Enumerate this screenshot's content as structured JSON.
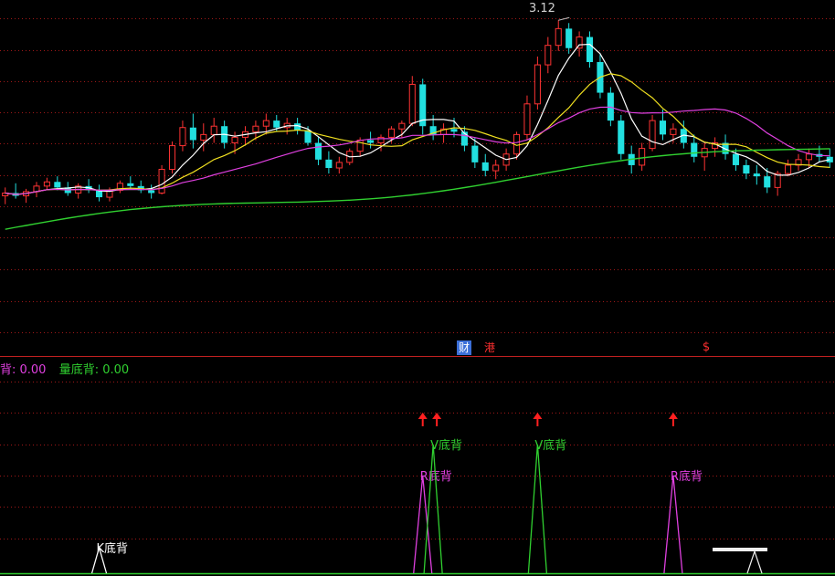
{
  "chart_data": [
    {
      "type": "candlestick",
      "peak_label": "3.12",
      "badges": [
        {
          "text": "财",
          "bg": "#3b6fd8",
          "fg": "#ffffff"
        },
        {
          "text": "港",
          "bg": "#000000",
          "fg": "#ff3030"
        },
        {
          "text": "$",
          "bg": "#000000",
          "fg": "#ff3030"
        }
      ],
      "colors": {
        "up": "#ff3333",
        "down": "#22e0e0",
        "ma5": "#ffffff",
        "ma10": "#f0e020",
        "ma20": "#e040e0",
        "ma60": "#30d030"
      },
      "price_range": [
        1.3,
        3.2
      ],
      "ohlc": [
        [
          1.86,
          1.92,
          1.8,
          1.88
        ],
        [
          1.88,
          1.95,
          1.84,
          1.86
        ],
        [
          1.86,
          1.91,
          1.81,
          1.89
        ],
        [
          1.89,
          1.96,
          1.85,
          1.93
        ],
        [
          1.93,
          1.99,
          1.9,
          1.96
        ],
        [
          1.96,
          2.0,
          1.9,
          1.92
        ],
        [
          1.92,
          1.96,
          1.86,
          1.88
        ],
        [
          1.88,
          1.95,
          1.84,
          1.93
        ],
        [
          1.93,
          1.98,
          1.88,
          1.9
        ],
        [
          1.9,
          1.94,
          1.82,
          1.85
        ],
        [
          1.85,
          1.92,
          1.82,
          1.9
        ],
        [
          1.9,
          1.97,
          1.88,
          1.95
        ],
        [
          1.95,
          2.0,
          1.91,
          1.93
        ],
        [
          1.93,
          1.97,
          1.88,
          1.9
        ],
        [
          1.9,
          1.94,
          1.84,
          1.88
        ],
        [
          1.88,
          2.08,
          1.87,
          2.05
        ],
        [
          2.05,
          2.25,
          2.02,
          2.22
        ],
        [
          2.22,
          2.4,
          2.18,
          2.35
        ],
        [
          2.35,
          2.45,
          2.2,
          2.26
        ],
        [
          2.26,
          2.38,
          2.18,
          2.3
        ],
        [
          2.3,
          2.42,
          2.24,
          2.36
        ],
        [
          2.36,
          2.4,
          2.2,
          2.24
        ],
        [
          2.24,
          2.32,
          2.16,
          2.28
        ],
        [
          2.28,
          2.36,
          2.22,
          2.32
        ],
        [
          2.32,
          2.4,
          2.26,
          2.36
        ],
        [
          2.36,
          2.45,
          2.3,
          2.4
        ],
        [
          2.4,
          2.44,
          2.32,
          2.35
        ],
        [
          2.35,
          2.42,
          2.3,
          2.38
        ],
        [
          2.38,
          2.42,
          2.3,
          2.33
        ],
        [
          2.33,
          2.36,
          2.22,
          2.24
        ],
        [
          2.24,
          2.28,
          2.08,
          2.12
        ],
        [
          2.12,
          2.18,
          2.02,
          2.06
        ],
        [
          2.06,
          2.14,
          2.02,
          2.1
        ],
        [
          2.1,
          2.2,
          2.08,
          2.18
        ],
        [
          2.18,
          2.28,
          2.14,
          2.26
        ],
        [
          2.26,
          2.32,
          2.2,
          2.24
        ],
        [
          2.24,
          2.3,
          2.18,
          2.28
        ],
        [
          2.28,
          2.36,
          2.24,
          2.34
        ],
        [
          2.34,
          2.4,
          2.28,
          2.38
        ],
        [
          2.38,
          2.72,
          2.36,
          2.66
        ],
        [
          2.66,
          2.7,
          2.3,
          2.36
        ],
        [
          2.36,
          2.44,
          2.26,
          2.3
        ],
        [
          2.3,
          2.38,
          2.24,
          2.34
        ],
        [
          2.34,
          2.42,
          2.28,
          2.32
        ],
        [
          2.32,
          2.36,
          2.18,
          2.22
        ],
        [
          2.22,
          2.28,
          2.06,
          2.1
        ],
        [
          2.1,
          2.16,
          2.0,
          2.04
        ],
        [
          2.04,
          2.12,
          1.98,
          2.08
        ],
        [
          2.08,
          2.2,
          2.04,
          2.16
        ],
        [
          2.16,
          2.32,
          2.12,
          2.3
        ],
        [
          2.3,
          2.58,
          2.26,
          2.52
        ],
        [
          2.52,
          2.86,
          2.48,
          2.8
        ],
        [
          2.8,
          3.0,
          2.74,
          2.94
        ],
        [
          2.94,
          3.12,
          2.9,
          3.06
        ],
        [
          3.06,
          3.1,
          2.88,
          2.92
        ],
        [
          2.92,
          3.04,
          2.86,
          3.0
        ],
        [
          3.0,
          3.04,
          2.78,
          2.82
        ],
        [
          2.82,
          2.88,
          2.56,
          2.6
        ],
        [
          2.6,
          2.64,
          2.36,
          2.4
        ],
        [
          2.4,
          2.44,
          2.12,
          2.16
        ],
        [
          2.16,
          2.22,
          2.02,
          2.08
        ],
        [
          2.08,
          2.24,
          2.04,
          2.2
        ],
        [
          2.2,
          2.44,
          2.18,
          2.4
        ],
        [
          2.4,
          2.48,
          2.26,
          2.3
        ],
        [
          2.3,
          2.38,
          2.24,
          2.34
        ],
        [
          2.34,
          2.4,
          2.2,
          2.24
        ],
        [
          2.24,
          2.3,
          2.1,
          2.14
        ],
        [
          2.14,
          2.24,
          2.04,
          2.2
        ],
        [
          2.2,
          2.28,
          2.14,
          2.24
        ],
        [
          2.24,
          2.3,
          2.12,
          2.16
        ],
        [
          2.16,
          2.2,
          2.04,
          2.08
        ],
        [
          2.08,
          2.12,
          1.98,
          2.02
        ],
        [
          2.02,
          2.08,
          1.94,
          2.0
        ],
        [
          2.0,
          2.06,
          1.88,
          1.92
        ],
        [
          1.92,
          2.04,
          1.86,
          2.02
        ],
        [
          2.02,
          2.12,
          2.0,
          2.08
        ],
        [
          2.08,
          2.16,
          2.04,
          2.12
        ],
        [
          2.12,
          2.2,
          2.06,
          2.16
        ],
        [
          2.16,
          2.22,
          2.1,
          2.14
        ],
        [
          2.14,
          2.2,
          2.06,
          2.1
        ]
      ]
    },
    {
      "type": "line",
      "legend": [
        {
          "text": "背: 0.00",
          "color": "#e040e0"
        },
        {
          "text": "量底背: 0.00",
          "color": "#30d030"
        }
      ],
      "signals": [
        {
          "label": "K底背",
          "color": "#ffffff",
          "index": 9
        },
        {
          "label": "R底背",
          "color": "#e040e0",
          "index": 40
        },
        {
          "label": "V底背",
          "color": "#30d030",
          "index": 41
        },
        {
          "label": "V底背",
          "color": "#30d030",
          "index": 51
        },
        {
          "label": "R底背",
          "color": "#e040e0",
          "index": 64
        }
      ],
      "arrows": [
        40,
        41,
        51,
        64
      ],
      "arrow_color": "#ff2020"
    }
  ]
}
